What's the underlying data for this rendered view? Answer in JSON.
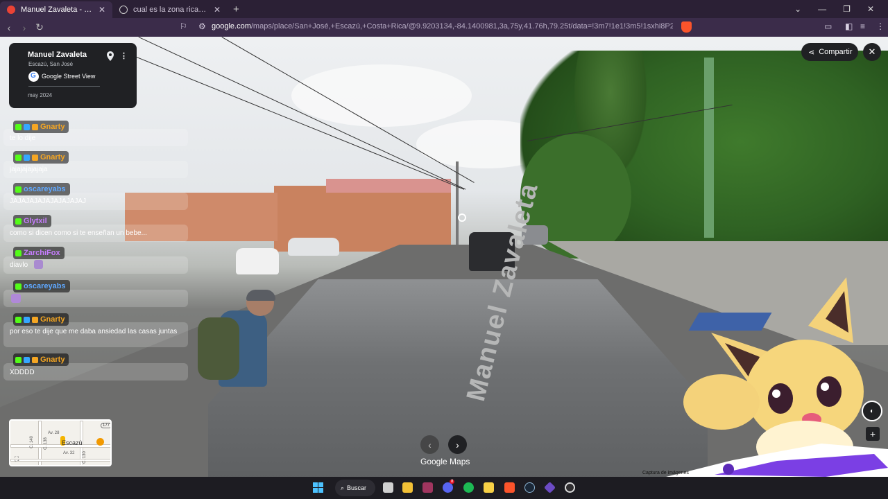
{
  "browser": {
    "tabs": [
      {
        "title": "Manuel Zavaleta - Google Maps",
        "active": true
      },
      {
        "title": "cual es la zona rica de costa rica - Bu",
        "active": false
      }
    ],
    "url_host": "google.com",
    "url_path": "/maps/place/San+José,+Escazú,+Costa+Rica/@9.9203134,-84.1400981,3a,75y,41.76h,79.25t/data=!3m7!1e1!3m5!1sxhi8P2Ciw6LqfE17Pt4BxQ!2e0!..."
  },
  "streetview": {
    "place_title": "Manuel Zavaleta",
    "place_subtitle": "Escazú, San José",
    "provider": "Google Street View",
    "date": "may 2024",
    "share_label": "Compartir",
    "road_marking": "Manuel Zavaleta",
    "brand": "Google Maps",
    "capture_note": "Captura de imágenes"
  },
  "minimap": {
    "town": "Escazú",
    "labels": [
      "Av. 28",
      "Av. 32",
      "C. 140",
      "C. 138",
      "C. 130"
    ],
    "route_badge": "177"
  },
  "chat": [
    {
      "user": "Gnarty",
      "color": "#f5a623",
      "badges": true,
      "text": "te lo dije"
    },
    {
      "user": "Gnarty",
      "color": "#f5a623",
      "badges": true,
      "text": "jajajajajajaja"
    },
    {
      "user": "oscareyabs",
      "color": "#5fa8ff",
      "badges": false,
      "text": "JAJAJAJAJAJAJAJAJAJ"
    },
    {
      "user": "Glytxil",
      "color": "#c77dff",
      "badges": false,
      "text": "como si dicen como si te enseñan un bebe..."
    },
    {
      "user": "ZarchiFox",
      "color": "#c77dff",
      "badges": false,
      "text": "diavlo"
    },
    {
      "user": "oscareyabs",
      "color": "#5fa8ff",
      "badges": false,
      "text": ""
    },
    {
      "user": "Gnarty",
      "color": "#f5a623",
      "badges": true,
      "text": "por eso te dije que me daba ansiedad las casas juntas"
    },
    {
      "user": "Gnarty",
      "color": "#f5a623",
      "badges": true,
      "text": "XDDDD"
    }
  ],
  "taskbar": {
    "search_label": "Buscar",
    "notification_count": "8"
  },
  "colors": {
    "browser_chrome": "#3b2c4a",
    "maps_panel": "#202124",
    "accent_purple": "#7b3fe4"
  }
}
